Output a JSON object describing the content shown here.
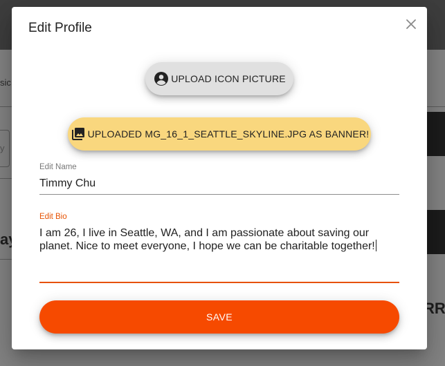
{
  "background_page": {
    "fragment_left_1": "sic",
    "fragment_left_2": "y",
    "fragment_left_3": "ay",
    "fragment_right": "RRI"
  },
  "dialog": {
    "title": "Edit Profile",
    "close_icon": "close-icon",
    "upload_icon_button": {
      "label": "UPLOAD ICON PICTURE",
      "icon": "account-circle-icon",
      "color": "#e0e0e0"
    },
    "banner_button": {
      "label": "UPLOADED MG_16_1_SEATTLE_SKYLINE.JPG AS BANNER!",
      "icon": "photo-library-icon",
      "color": "#f9d77e"
    },
    "name_field": {
      "label": "Edit Name",
      "value": "Timmy Chu"
    },
    "bio_field": {
      "label": "Edit Bio",
      "line1": "I am 26, I live in Seattle, WA, and I am passionate about saving our",
      "line2": "planet. Nice to meet everyone, I hope we can be charitable together!"
    },
    "save_button": {
      "label": "SAVE",
      "color": "#f64a00"
    },
    "accent_color": "#e65100"
  }
}
